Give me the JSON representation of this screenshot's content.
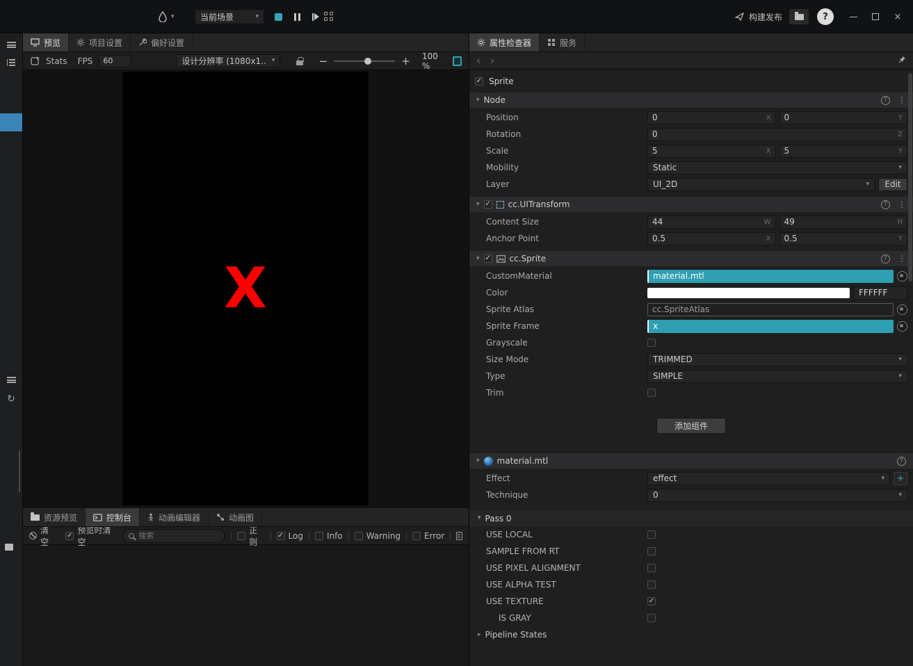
{
  "titlebar": {
    "scene_select": "当前场景",
    "build_label": "构建发布"
  },
  "preview": {
    "tabs": {
      "preview": "预览",
      "project": "项目设置",
      "prefs": "偏好设置"
    },
    "toolbar": {
      "stats": "Stats",
      "fps_label": "FPS",
      "fps_value": "60",
      "resolution": "设计分辨率 (1080x1...",
      "zoom": "100 %"
    },
    "canvas_text": "X"
  },
  "console": {
    "tabs": {
      "assets": "资源预览",
      "console": "控制台",
      "anim_editor": "动画编辑器",
      "anim_graph": "动画图"
    },
    "toolbar": {
      "clear": "清空",
      "clear_on_preview": "预览时清空",
      "clear_on_preview_checked": true,
      "search_placeholder": "搜索",
      "regex": "正则",
      "log": "Log",
      "log_checked": true,
      "info": "Info",
      "warning": "Warning",
      "error": "Error"
    }
  },
  "inspector": {
    "tabs": {
      "inspector": "属性检查器",
      "service": "服务"
    },
    "node_header": {
      "name": "Sprite",
      "checked": true
    },
    "node": {
      "title": "Node",
      "rows": {
        "position": {
          "label": "Position",
          "x": "0",
          "y": "0",
          "unit_x": "X",
          "unit_y": "Y"
        },
        "rotation": {
          "label": "Rotation",
          "z": "0",
          "unit_z": "Z"
        },
        "scale": {
          "label": "Scale",
          "x": "5",
          "y": "5",
          "unit_x": "X",
          "unit_y": "Y"
        },
        "mobility": {
          "label": "Mobility",
          "value": "Static"
        },
        "layer": {
          "label": "Layer",
          "value": "UI_2D",
          "edit": "Edit"
        }
      }
    },
    "uitransform": {
      "title": "cc.UITransform",
      "checked": true,
      "rows": {
        "content_size": {
          "label": "Content Size",
          "w": "44",
          "h": "49",
          "unit_w": "W",
          "unit_h": "H"
        },
        "anchor": {
          "label": "Anchor Point",
          "x": "0.5",
          "y": "0.5",
          "unit_x": "X",
          "unit_y": "Y"
        }
      }
    },
    "sprite": {
      "title": "cc.Sprite",
      "checked": true,
      "rows": {
        "custom_material": {
          "label": "CustomMaterial",
          "value": "material.mtl"
        },
        "color": {
          "label": "Color",
          "hex": "FFFFFF"
        },
        "sprite_atlas": {
          "label": "Sprite Atlas",
          "value": "cc.SpriteAtlas"
        },
        "sprite_frame": {
          "label": "Sprite Frame",
          "value": "x"
        },
        "grayscale": {
          "label": "Grayscale",
          "checked": false
        },
        "size_mode": {
          "label": "Size Mode",
          "value": "TRIMMED"
        },
        "type": {
          "label": "Type",
          "value": "SIMPLE"
        },
        "trim": {
          "label": "Trim",
          "checked": false
        }
      }
    },
    "add_component": "添加组件",
    "material": {
      "title": "material.mtl",
      "rows": {
        "effect": {
          "label": "Effect",
          "value": "effect"
        },
        "technique": {
          "label": "Technique",
          "value": "0"
        }
      },
      "pass0": {
        "title": "Pass 0",
        "flags": [
          {
            "label": "USE LOCAL",
            "checked": false
          },
          {
            "label": "SAMPLE FROM RT",
            "checked": false
          },
          {
            "label": "USE PIXEL ALIGNMENT",
            "checked": false
          },
          {
            "label": "USE ALPHA TEST",
            "checked": false
          },
          {
            "label": "USE TEXTURE",
            "checked": true
          },
          {
            "label": "IS GRAY",
            "checked": false
          }
        ],
        "pipeline": "Pipeline States"
      }
    }
  },
  "colors": {
    "accent": "#2f9fb2",
    "selection_blue": "#3a84b8",
    "sprite_red": "#ff0000",
    "color_hex_value": "FFFFFF"
  }
}
